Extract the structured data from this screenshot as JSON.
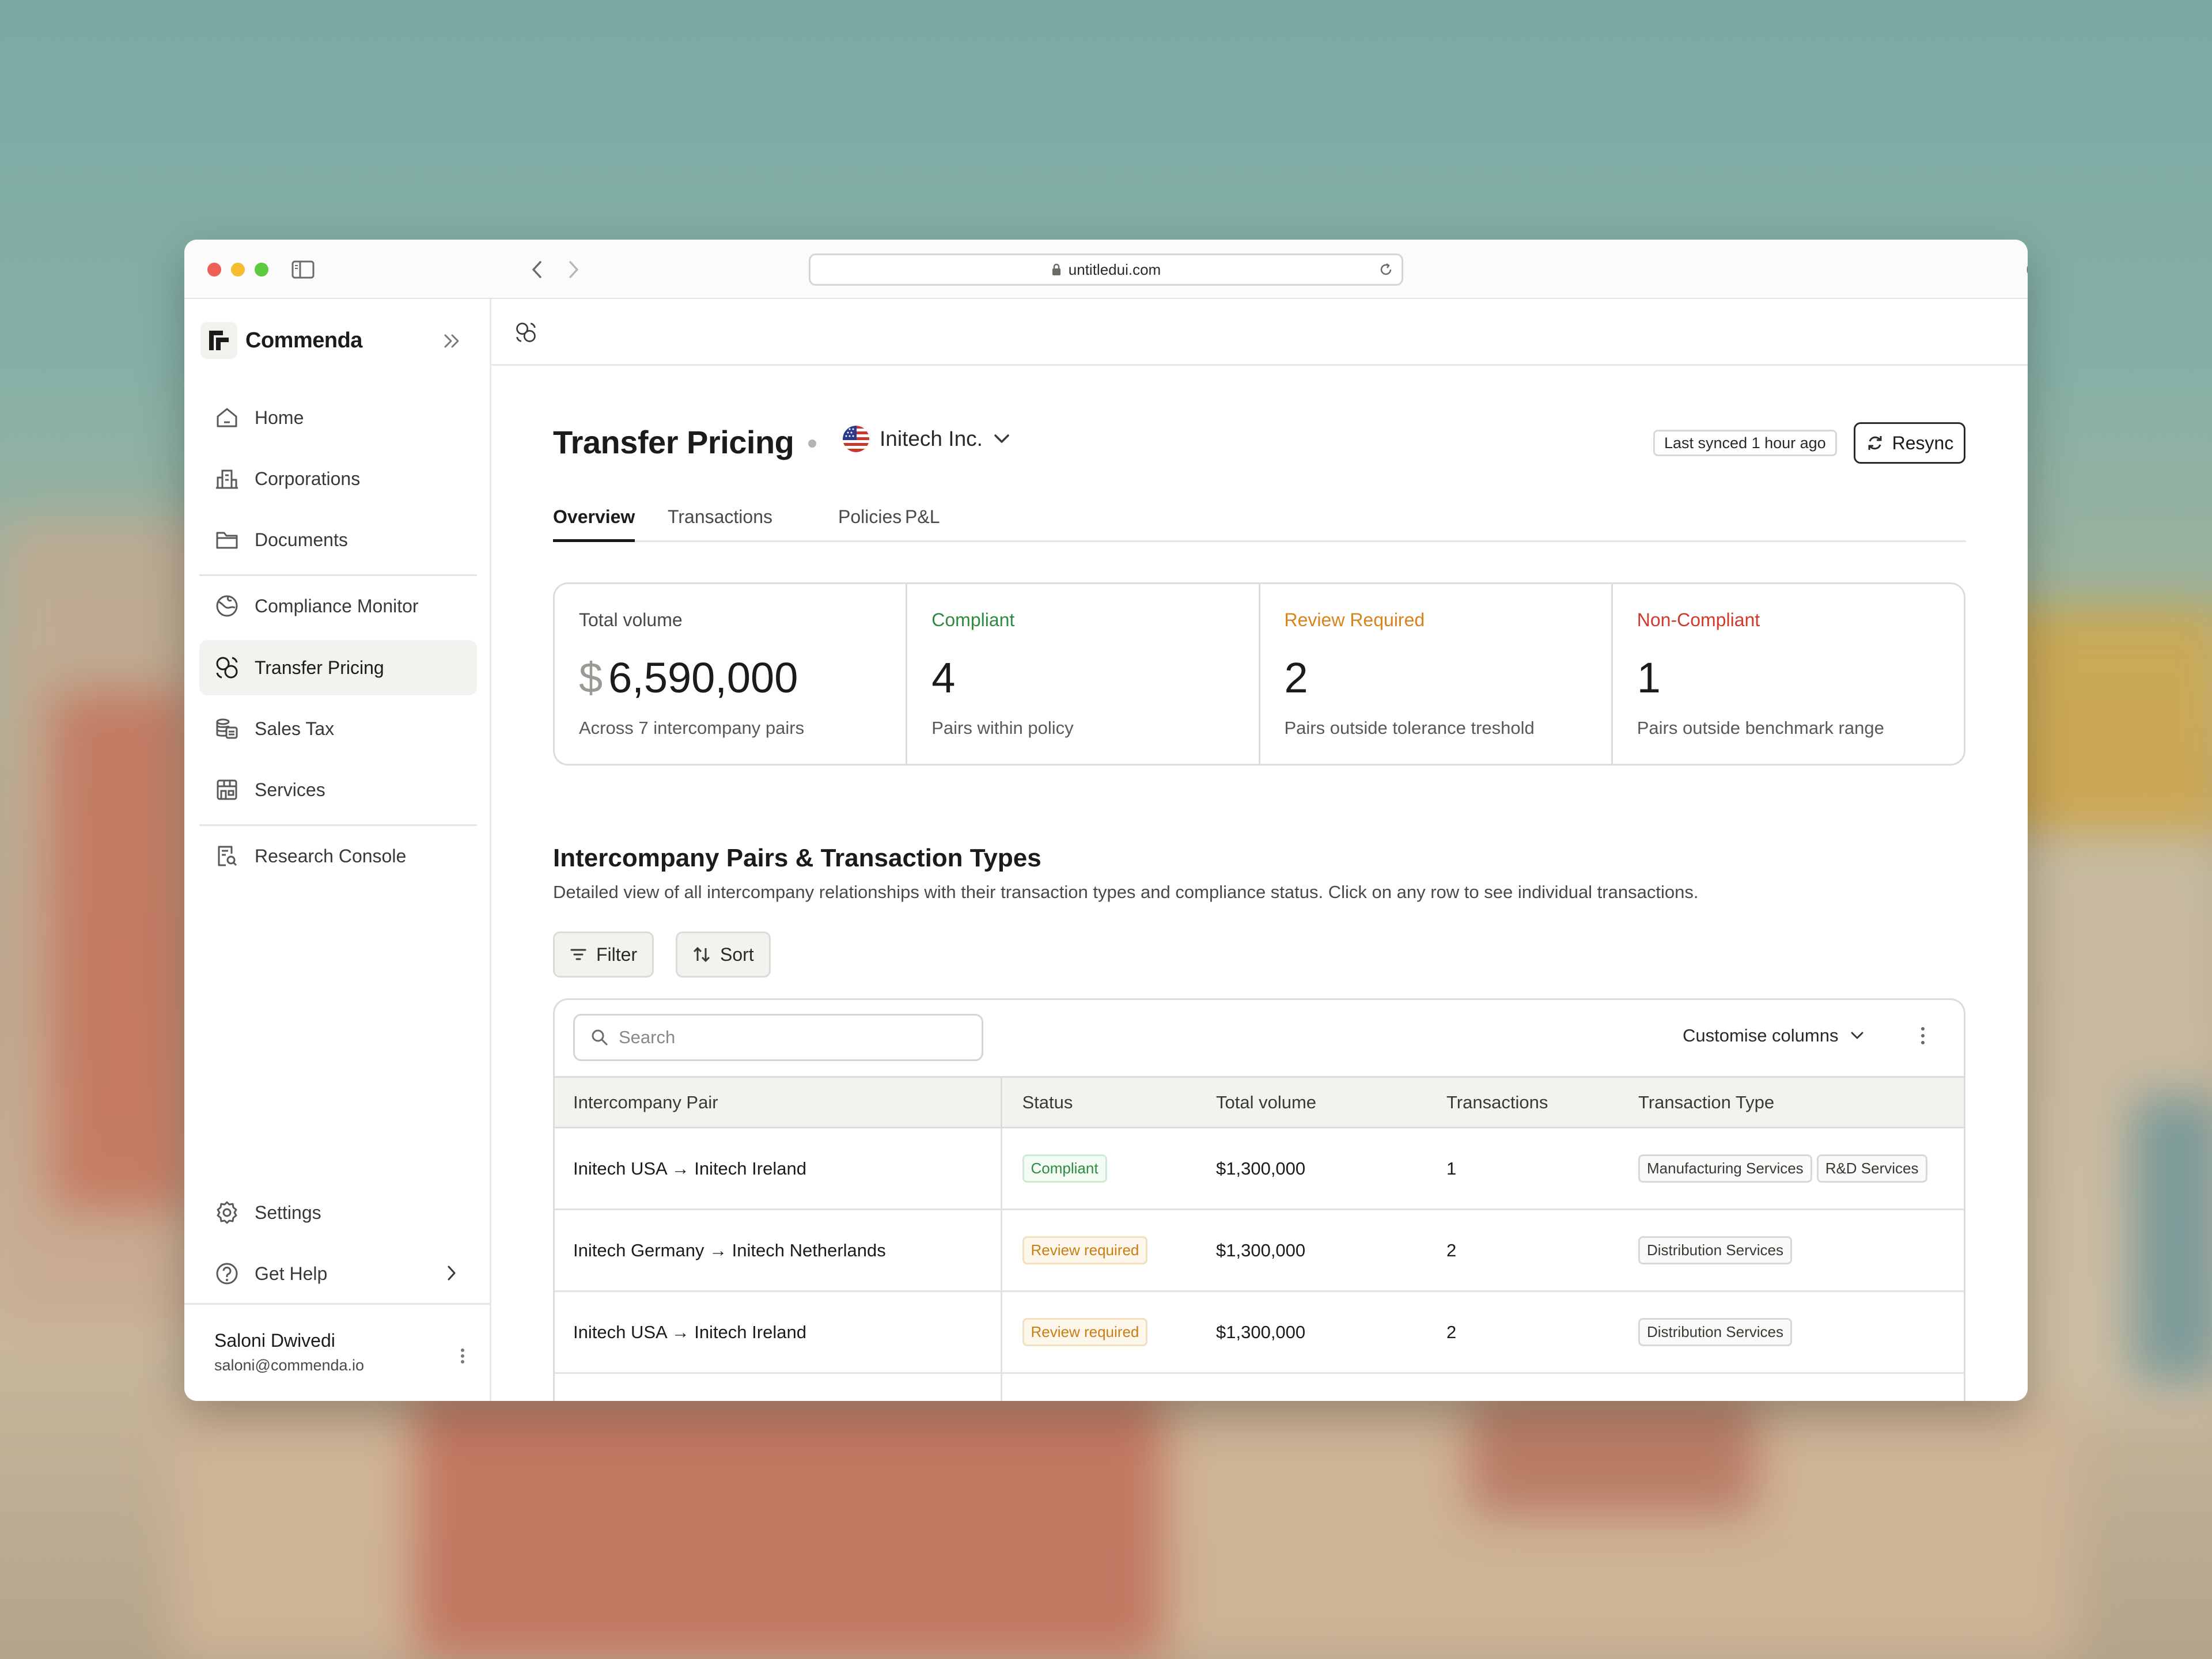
{
  "browser": {
    "url": "untitledui.com"
  },
  "sidebar": {
    "brand": "Commenda",
    "items": [
      {
        "label": "Home",
        "icon": "home-icon"
      },
      {
        "label": "Corporations",
        "icon": "building-icon"
      },
      {
        "label": "Documents",
        "icon": "folder-icon"
      },
      {
        "label": "Compliance Monitor",
        "icon": "compliance-icon"
      },
      {
        "label": "Transfer Pricing",
        "icon": "transfer-pricing-icon",
        "active": true
      },
      {
        "label": "Sales Tax",
        "icon": "coins-icon"
      },
      {
        "label": "Services",
        "icon": "store-icon"
      },
      {
        "label": "Research Console",
        "icon": "research-icon"
      }
    ],
    "footer_items": [
      {
        "label": "Settings",
        "icon": "gear-icon"
      },
      {
        "label": "Get Help",
        "icon": "help-icon"
      }
    ],
    "user": {
      "name": "Saloni Dwivedi",
      "email": "saloni@commenda.io"
    }
  },
  "header": {
    "title": "Transfer Pricing",
    "entity": "Initech Inc.",
    "sync_status": "Last synced 1 hour ago",
    "resync_label": "Resync"
  },
  "tabs": [
    "Overview",
    "Transactions",
    "Policies",
    "P&L"
  ],
  "stats": [
    {
      "label": "Total volume",
      "currency": "$",
      "value": "6,590,000",
      "sub": "Across 7 intercompany pairs",
      "color": "#4a4946"
    },
    {
      "label": "Compliant",
      "currency": "",
      "value": "4",
      "sub": "Pairs within policy",
      "color": "#2e8b3f"
    },
    {
      "label": "Review Required",
      "currency": "",
      "value": "2",
      "sub": "Pairs outside tolerance treshold",
      "color": "#d9831a"
    },
    {
      "label": "Non-Compliant",
      "currency": "",
      "value": "1",
      "sub": "Pairs outside benchmark range",
      "color": "#d03a2c"
    }
  ],
  "section": {
    "title": "Intercompany Pairs & Transaction Types",
    "description": "Detailed view of all intercompany relationships with their transaction types and compliance status. Click on any row to see individual transactions.",
    "filter_label": "Filter",
    "sort_label": "Sort"
  },
  "table": {
    "search_placeholder": "Search",
    "customise_label": "Customise columns",
    "columns": [
      "Intercompany Pair",
      "Status",
      "Total volume",
      "Transactions",
      "Transaction Type"
    ],
    "rows": [
      {
        "pair": "Initech USA → Initech Ireland",
        "status": "Compliant",
        "status_kind": "compliant",
        "volume": "$1,300,000",
        "transactions": "1",
        "types": [
          "Manufacturing Services",
          "R&D Services"
        ]
      },
      {
        "pair": "Initech Germany → Initech Netherlands",
        "status": "Review required",
        "status_kind": "review",
        "volume": "$1,300,000",
        "transactions": "2",
        "types": [
          "Distribution Services"
        ]
      },
      {
        "pair": "Initech USA → Initech Ireland",
        "status": "Review required",
        "status_kind": "review",
        "volume": "$1,300,000",
        "transactions": "2",
        "types": [
          "Distribution Services"
        ]
      }
    ]
  }
}
